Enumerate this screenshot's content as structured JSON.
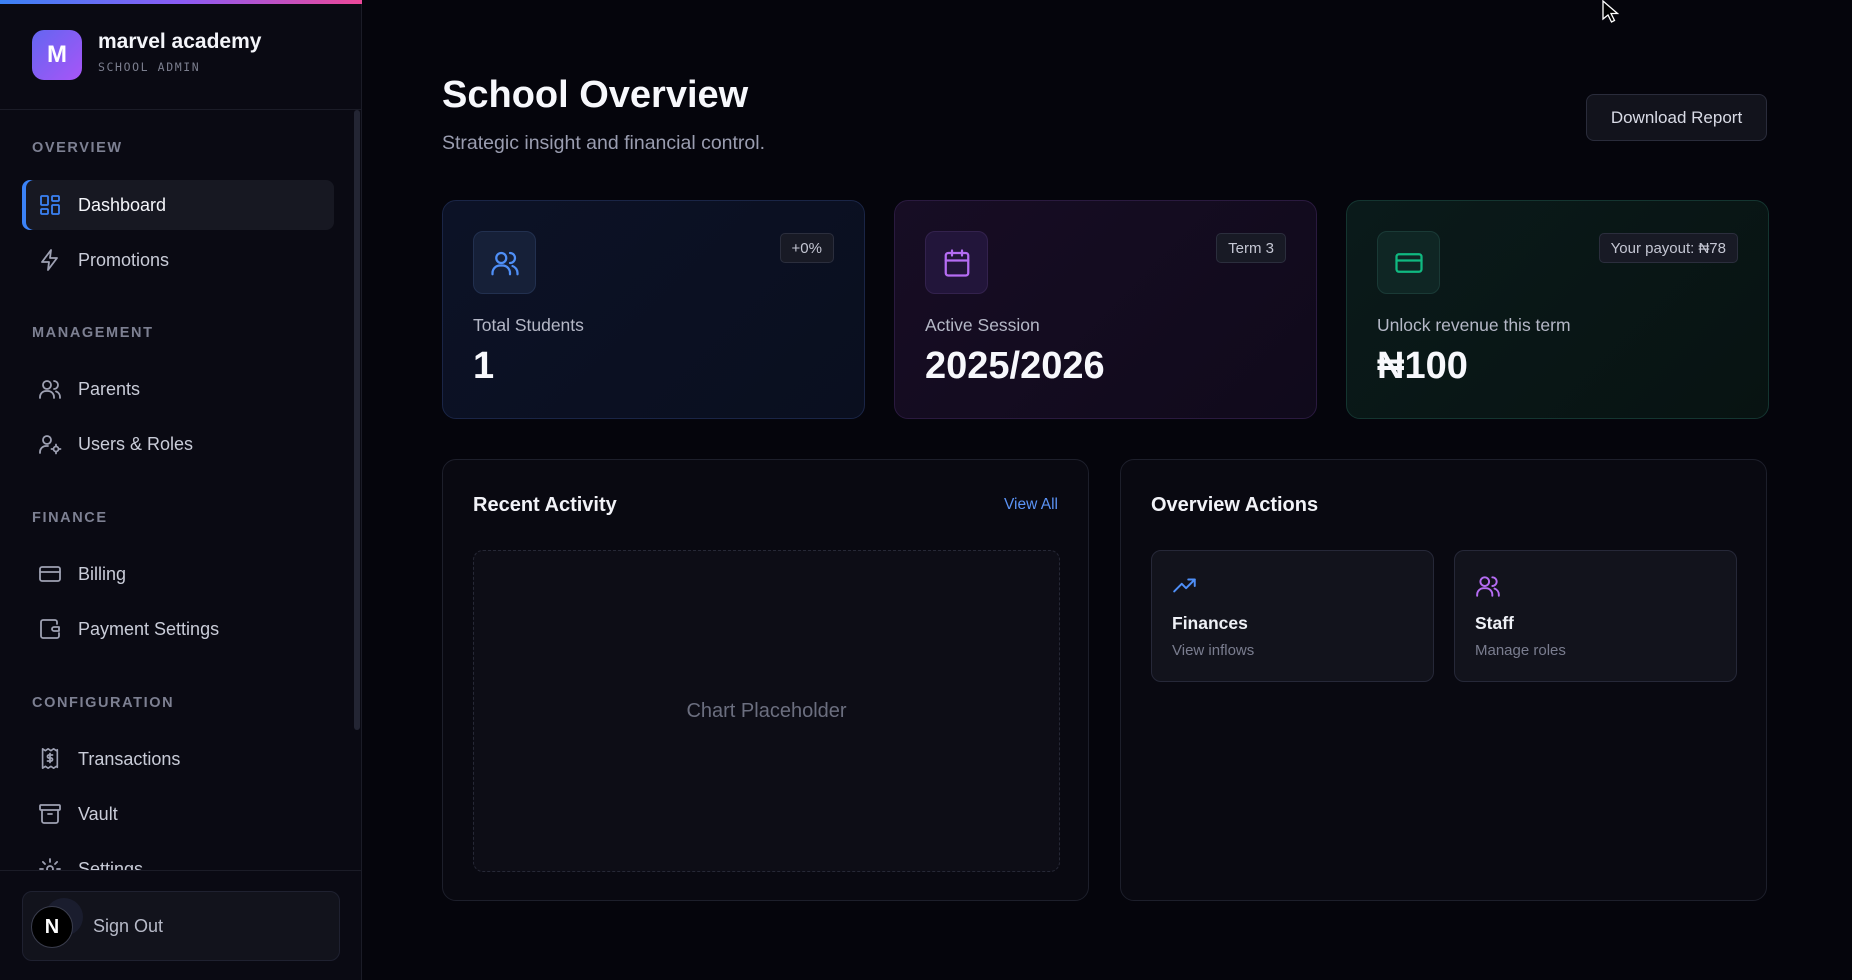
{
  "brand": {
    "initial": "M",
    "name": "marvel academy",
    "subtitle": "SCHOOL ADMIN"
  },
  "sidebar": {
    "sections": [
      {
        "title": "OVERVIEW"
      },
      {
        "title": "MANAGEMENT"
      },
      {
        "title": "FINANCE"
      },
      {
        "title": "CONFIGURATION"
      }
    ],
    "items": [
      {
        "label": "Dashboard",
        "icon": "dashboard-grid-icon",
        "active": true
      },
      {
        "label": "Promotions",
        "icon": "lightning-icon"
      },
      {
        "label": "Parents",
        "icon": "users-icon"
      },
      {
        "label": "Users & Roles",
        "icon": "user-gear-icon"
      },
      {
        "label": "Billing",
        "icon": "credit-card-icon"
      },
      {
        "label": "Payment Settings",
        "icon": "wallet-icon"
      },
      {
        "label": "Transactions",
        "icon": "receipt-dollar-icon"
      },
      {
        "label": "Vault",
        "icon": "archive-icon"
      },
      {
        "label": "Settings",
        "icon": "gear-icon"
      }
    ],
    "signout_label": "Sign Out",
    "avatar_initial": "N"
  },
  "header": {
    "title": "School Overview",
    "subtitle": "Strategic insight and financial control.",
    "download_label": "Download Report"
  },
  "stats": [
    {
      "label": "Total Students",
      "value": "1",
      "badge": "+0%",
      "icon": "users-icon",
      "accent": "#4f8ff7"
    },
    {
      "label": "Active Session",
      "value": "2025/2026",
      "badge": "Term 3",
      "icon": "calendar-icon",
      "accent": "#b56cf3"
    },
    {
      "label": "Unlock revenue this term",
      "value": "₦100",
      "badge": "Your payout: ₦78",
      "icon": "credit-card-icon",
      "accent": "#10b981"
    }
  ],
  "activity": {
    "title": "Recent Activity",
    "view_all": "View All",
    "placeholder": "Chart Placeholder"
  },
  "actions": {
    "title": "Overview Actions",
    "cards": [
      {
        "title": "Finances",
        "subtitle": "View inflows",
        "icon": "trending-up-icon"
      },
      {
        "title": "Staff",
        "subtitle": "Manage roles",
        "icon": "users-icon"
      }
    ]
  },
  "colors": {
    "accent_blue": "#3b82f6",
    "accent_purple": "#a855f7",
    "accent_green": "#10b981",
    "background": "#05050c"
  }
}
